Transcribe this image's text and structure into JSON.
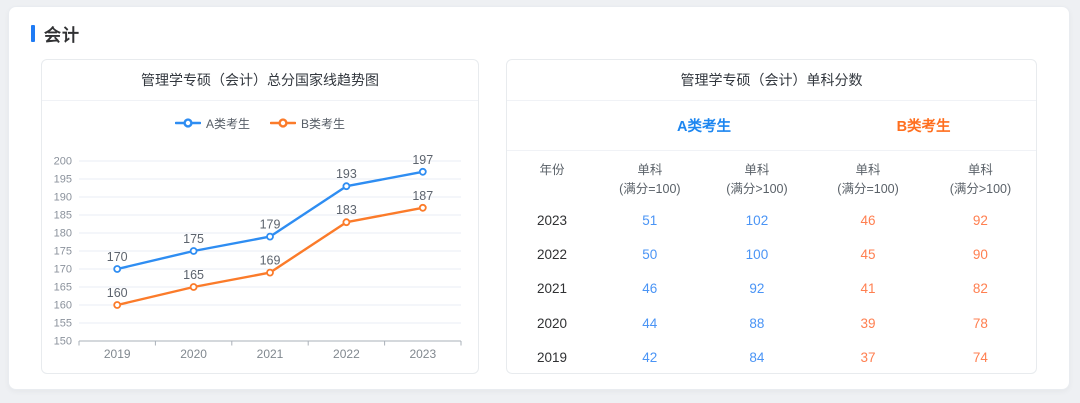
{
  "section": {
    "title": "会计"
  },
  "colors": {
    "accent_bar": "#1f7bf4",
    "series_a_blue": "#2e8df2",
    "series_b_orange": "#fb7b2a",
    "table_value_blue": "#4a94f5",
    "table_value_orange": "#ff7f50",
    "group_a_blue": "#1d86f0",
    "group_b_orange": "#ff6f1f"
  },
  "chart_data": [
    {
      "type": "line",
      "title": "管理学专硕（会计）总分国家线趋势图",
      "x": [
        "2019",
        "2020",
        "2021",
        "2022",
        "2023"
      ],
      "series": [
        {
          "name": "A类考生",
          "color": "#2e8df2",
          "values": [
            170,
            175,
            179,
            193,
            197
          ]
        },
        {
          "name": "B类考生",
          "color": "#fb7b2a",
          "values": [
            160,
            165,
            169,
            183,
            187
          ]
        }
      ],
      "ylim": [
        150,
        200
      ],
      "ytick_step": 5,
      "grid": true,
      "legend_position": "top",
      "xlabel": "",
      "ylabel": "",
      "point_labels": true
    },
    {
      "type": "table",
      "title": "管理学专硕（会计）单科分数",
      "column_groups": [
        {
          "label": "A类考生",
          "span": [
            1,
            2
          ]
        },
        {
          "label": "B类考生",
          "span": [
            3,
            4
          ]
        }
      ],
      "columns": [
        [
          "年份",
          ""
        ],
        [
          "单科",
          "(满分=100)"
        ],
        [
          "单科",
          "(满分>100)"
        ],
        [
          "单科",
          "(满分=100)"
        ],
        [
          "单科",
          "(满分>100)"
        ]
      ],
      "rows": [
        [
          "2023",
          51,
          102,
          46,
          92
        ],
        [
          "2022",
          50,
          100,
          45,
          90
        ],
        [
          "2021",
          46,
          92,
          41,
          82
        ],
        [
          "2020",
          44,
          88,
          39,
          78
        ],
        [
          "2019",
          42,
          84,
          37,
          74
        ]
      ]
    }
  ]
}
